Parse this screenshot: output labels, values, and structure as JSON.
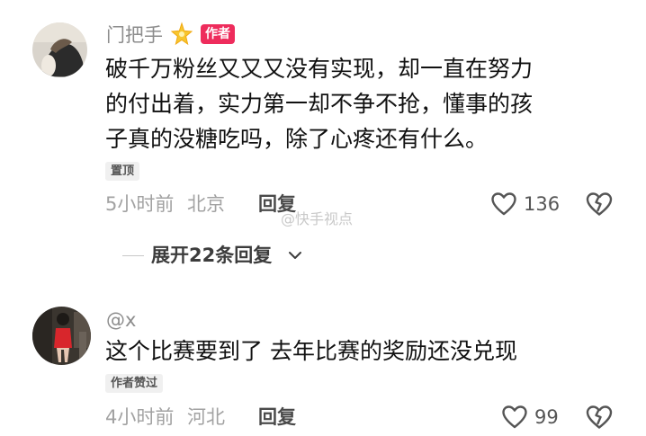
{
  "comments": [
    {
      "username": "门把手",
      "username_icon": "sparkle-star-icon",
      "author_badge": "作者",
      "text_lines": [
        "破千万粉丝又又又没有实现，却一直在努力",
        "的付出着，实力第一却不争不抢，懂事的孩",
        "子真的没糖吃吗，除了心疼还有什么。"
      ],
      "tag": "置顶",
      "time": "5小时前",
      "location": "北京",
      "reply_label": "回复",
      "like_count": "136",
      "expand_label": "展开22条回复"
    },
    {
      "username": "@x",
      "text_lines": [
        "这个比赛要到了 去年比赛的奖励还没兑现"
      ],
      "tag": "作者赞过",
      "time": "4小时前",
      "location": "河北",
      "reply_label": "回复",
      "like_count": "99"
    }
  ],
  "watermark": "@快手视点",
  "colors": {
    "author_badge": "#ee2c5c",
    "meta_text": "#a2a2a2",
    "username": "#8d8d8d"
  }
}
